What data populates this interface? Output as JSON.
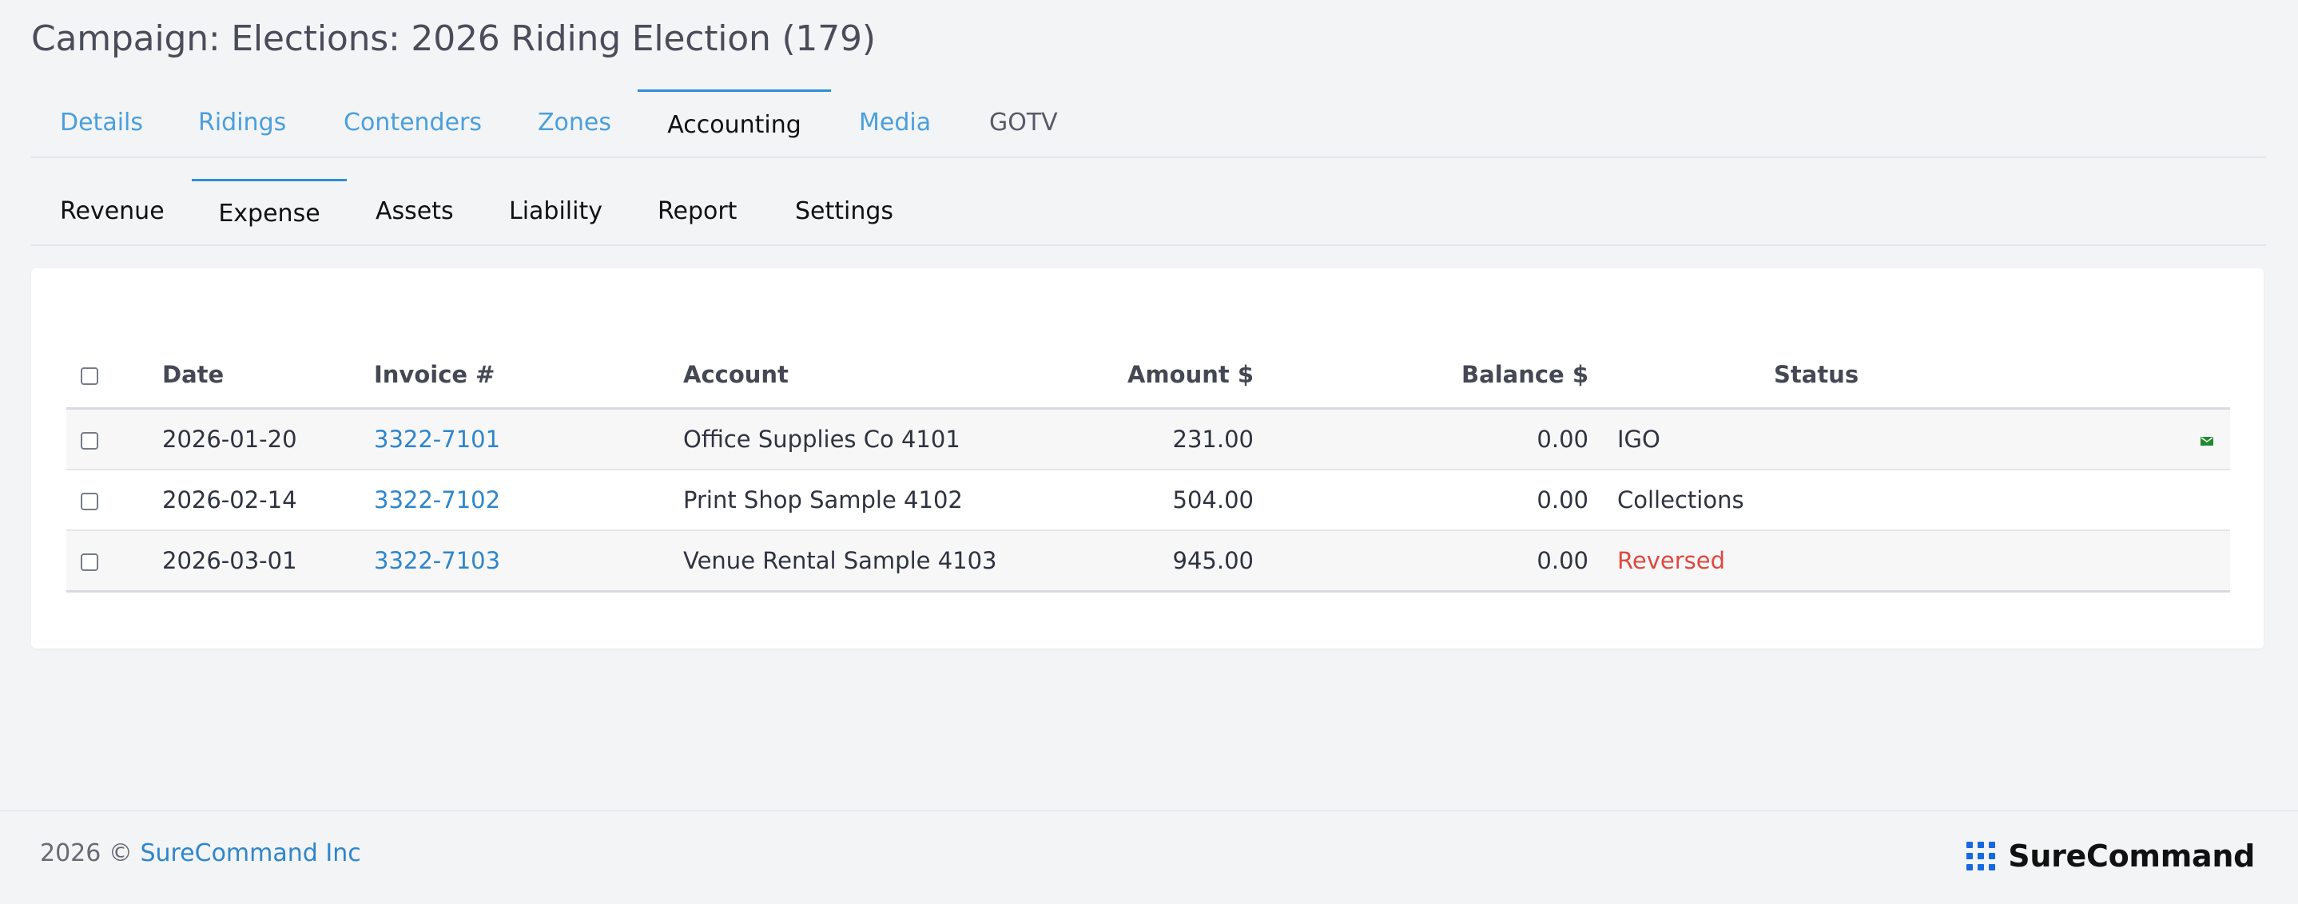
{
  "header": {
    "title": "Campaign: Elections: 2026 Riding Election (179)"
  },
  "main_tabs": [
    {
      "label": "Details"
    },
    {
      "label": "Ridings"
    },
    {
      "label": "Contenders"
    },
    {
      "label": "Zones"
    },
    {
      "label": "Accounting"
    },
    {
      "label": "Media"
    },
    {
      "label": "GOTV"
    }
  ],
  "sub_tabs": [
    {
      "label": "Revenue"
    },
    {
      "label": "Expense"
    },
    {
      "label": "Assets"
    },
    {
      "label": "Liability"
    },
    {
      "label": "Report"
    },
    {
      "label": "Settings"
    }
  ],
  "table": {
    "columns": [
      {
        "label": ""
      },
      {
        "label": "Date"
      },
      {
        "label": "Invoice #"
      },
      {
        "label": "Account"
      },
      {
        "label": "Amount $"
      },
      {
        "label": "Balance $"
      },
      {
        "label": "Status"
      },
      {
        "label": ""
      }
    ],
    "rows": [
      {
        "date": "2026-01-20",
        "invoice": "3322-7101",
        "account": "Office Supplies Co 4101",
        "amount": "231.00",
        "balance": "0.00",
        "status": "IGO",
        "icon": "mail-icon"
      },
      {
        "date": "2026-02-14",
        "invoice": "3322-7102",
        "account": "Print Shop Sample 4102",
        "amount": "504.00",
        "balance": "0.00",
        "status": "Collections",
        "icon": ""
      },
      {
        "date": "2026-03-01",
        "invoice": "3322-7103",
        "account": "Venue Rental Sample 4103",
        "amount": "945.00",
        "balance": "0.00",
        "status": "Reversed",
        "icon": ""
      }
    ]
  },
  "footer": {
    "copyright_prefix": "2026 ©",
    "company_link": "SureCommand Inc",
    "brand_name": "SureCommand"
  },
  "colors": {
    "accent": "#2f8ed5",
    "link": "#2e86cc",
    "status_reversed": "#e0483f",
    "brand_blue": "#1769e0",
    "mail_icon": "#1f8a2e"
  }
}
